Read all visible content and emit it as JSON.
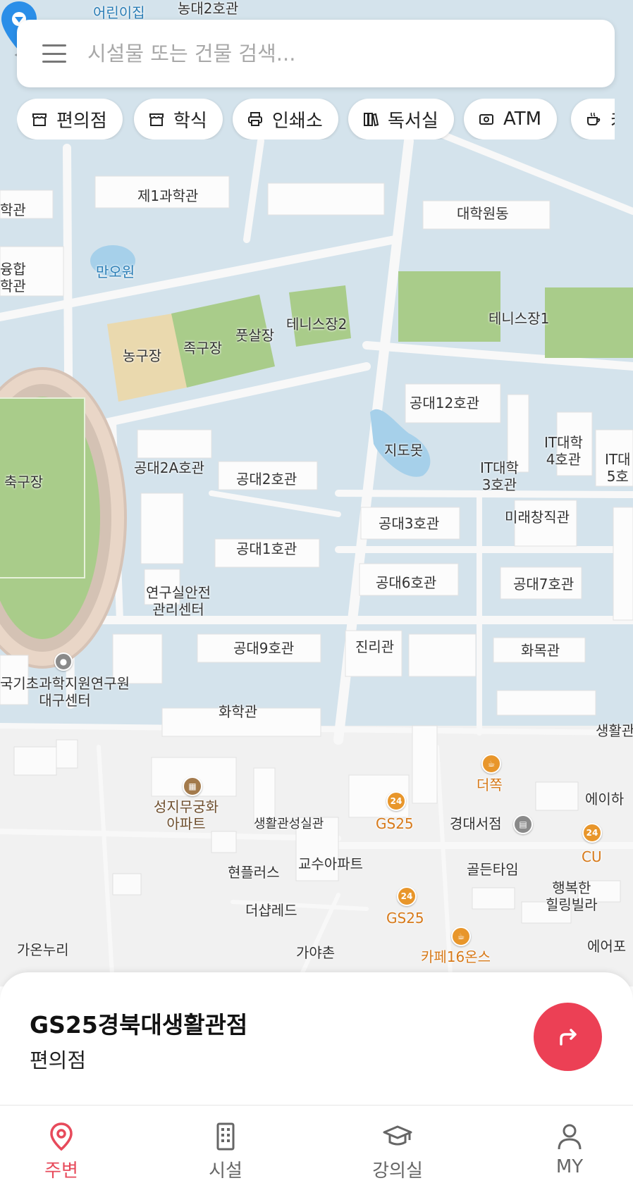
{
  "search": {
    "placeholder": "시설물 또는 건물 검색..."
  },
  "chips": [
    {
      "label": "편의점",
      "icon": "store-icon"
    },
    {
      "label": "학식",
      "icon": "store-icon"
    },
    {
      "label": "인쇄소",
      "icon": "printer-icon"
    },
    {
      "label": "독서실",
      "icon": "books-icon"
    },
    {
      "label": "ATM",
      "icon": "atm-icon"
    },
    {
      "label": "카",
      "icon": "coffee-icon"
    }
  ],
  "map": {
    "labels": {
      "daycare": "어린이집",
      "nongdae2": "농대2호관",
      "gwahak": "과학",
      "je1gwahak": "제1과학관",
      "hakgwan": "학관",
      "yunghap": "융합\n학관",
      "manowon": "만오원",
      "daehakwon": "대학원동",
      "tennis2": "테니스장2",
      "tennis1": "테니스장1",
      "nonggu": "농구장",
      "jokgu": "족구장",
      "futsal": "풋살장",
      "gongdae12": "공대12호관",
      "jidomot": "지도못",
      "it4": "IT대학\n4호관",
      "it3": "IT대학\n3호관",
      "it5": "IT대\n5호",
      "chukgu": "축구장",
      "gongdae2a": "공대2A호관",
      "gongdae2": "공대2호관",
      "gongdae3": "공대3호관",
      "miraechangjik": "미래창직관",
      "gongdae1": "공대1호관",
      "gongdae6": "공대6호관",
      "gongdae7": "공대7호관",
      "yeonguanjeon": "연구실안전\n관리센터",
      "gongdae9": "공대9호관",
      "jinrigwan": "진리관",
      "hwamokgwan": "화목관",
      "kbsi": "국기초과학지원연구원\n대구센터",
      "hwahak": "화학관",
      "saenghwal": "생활관",
      "seongji": "성지무궁화\n아파트",
      "saenghwalseongsil": "생활관성실관",
      "gs25_a": "GS25",
      "gyeongdaeseojeom": "경대서점",
      "deojjok": "더쪽",
      "eihae": "에이하",
      "cu": "CU",
      "hyeonplus": "현플러스",
      "gyosu": "교수아파트",
      "goldentime": "골든타임",
      "haengbok": "행복한\n힐링빌라",
      "deshapred": "더샵레드",
      "gs25_b": "GS25",
      "gaonnuri": "가온누리",
      "gayachon": "가야촌",
      "cafe16": "카페16온스",
      "eoepo": "에어포"
    },
    "poi_icons": {
      "gs25": "24",
      "cu": "24"
    }
  },
  "place": {
    "name": "GS25경북대생활관점",
    "category": "편의점"
  },
  "tabs": [
    {
      "label": "주변",
      "icon": "location-pin-icon",
      "active": true
    },
    {
      "label": "시설",
      "icon": "building-icon",
      "active": false
    },
    {
      "label": "강의실",
      "icon": "graduation-cap-icon",
      "active": false
    },
    {
      "label": "MY",
      "icon": "user-icon",
      "active": false
    }
  ],
  "colors": {
    "accent": "#ec4055",
    "active_tab": "#e74a5b",
    "poi": "#e8962b",
    "pin": "#2a8ee8"
  }
}
